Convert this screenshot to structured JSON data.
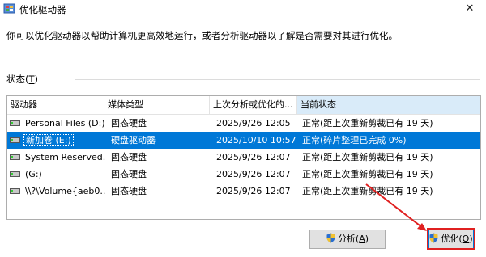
{
  "window": {
    "title": "优化驱动器",
    "close_glyph": "✕"
  },
  "description": "你可以优化驱动器以帮助计算机更高效地运行，或者分析驱动器以了解是否需要对其进行优化。",
  "status_section": {
    "label_prefix": "状态(",
    "label_hotkey": "T",
    "label_suffix": ")"
  },
  "table": {
    "columns": [
      "驱动器",
      "媒体类型",
      "上次分析或优化的...",
      "当前状态"
    ],
    "sorted_column": 3,
    "rows": [
      {
        "drive": "Personal Files (D:)",
        "media": "固态硬盘",
        "last": "2025/9/26 12:05",
        "status": "正常(距上次重新剪裁已有 19 天)",
        "icon": "drive-icon",
        "selected": false
      },
      {
        "drive": "新加卷 (E:)",
        "media": "硬盘驱动器",
        "last": "2025/10/10 10:57",
        "status": "正常(碎片整理已完成 0%)",
        "icon": "drive-icon",
        "selected": true
      },
      {
        "drive": "System Reserved...",
        "media": "固态硬盘",
        "last": "2025/9/26 12:07",
        "status": "正常(距上次重新剪裁已有 19 天)",
        "icon": "drive-icon",
        "selected": false
      },
      {
        "drive": "(G:)",
        "media": "固态硬盘",
        "last": "2025/9/26 12:07",
        "status": "正常(距上次重新剪裁已有 19 天)",
        "icon": "drive-icon",
        "selected": false
      },
      {
        "drive": "\\\\?\\Volume{aeb0...",
        "media": "固态硬盘",
        "last": "2025/9/26 12:07",
        "status": "正常(距上次重新剪裁已有 19 天)",
        "icon": "drive-icon",
        "selected": false
      }
    ]
  },
  "buttons": {
    "analyze": {
      "label_prefix": "分析(",
      "hotkey": "A",
      "label_suffix": ")",
      "icon": "shield-icon"
    },
    "optimize": {
      "label_prefix": "优化(",
      "hotkey": "O",
      "label_suffix": ")",
      "icon": "shield-icon"
    }
  },
  "colors": {
    "selection": "#0078d7",
    "annotation": "#e02020",
    "header_sorted": "#d9ebf9"
  }
}
